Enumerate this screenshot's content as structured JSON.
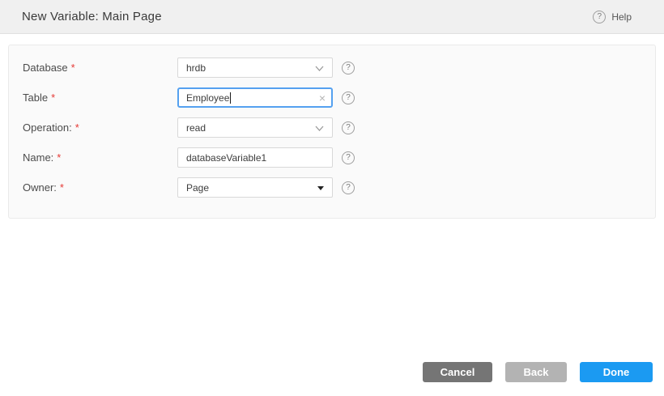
{
  "header": {
    "title": "New Variable: Main Page",
    "help_label": "Help"
  },
  "form": {
    "fields": [
      {
        "label": "Database",
        "required": "*",
        "type": "dropdown",
        "value": "hrdb"
      },
      {
        "label": "Table",
        "required": "*",
        "type": "text-focused",
        "value": "Employee"
      },
      {
        "label": "Operation:",
        "required": "*",
        "type": "dropdown",
        "value": "read"
      },
      {
        "label": "Name:",
        "required": "*",
        "type": "text",
        "value": "databaseVariable1"
      },
      {
        "label": "Owner:",
        "required": "*",
        "type": "native-select",
        "value": "Page"
      }
    ]
  },
  "footer": {
    "cancel_label": "Cancel",
    "back_label": "Back",
    "done_label": "Done"
  },
  "icons": {
    "help_glyph": "?",
    "clear_glyph": "×"
  },
  "colors": {
    "header_bg": "#f0f0f0",
    "panel_bg": "#fafafa",
    "accent_blue": "#1b9af2",
    "cancel_gray": "#757575",
    "back_gray": "#b3b3b3",
    "focus_border_blue": "#55a1f0",
    "required_red": "#e53935"
  }
}
